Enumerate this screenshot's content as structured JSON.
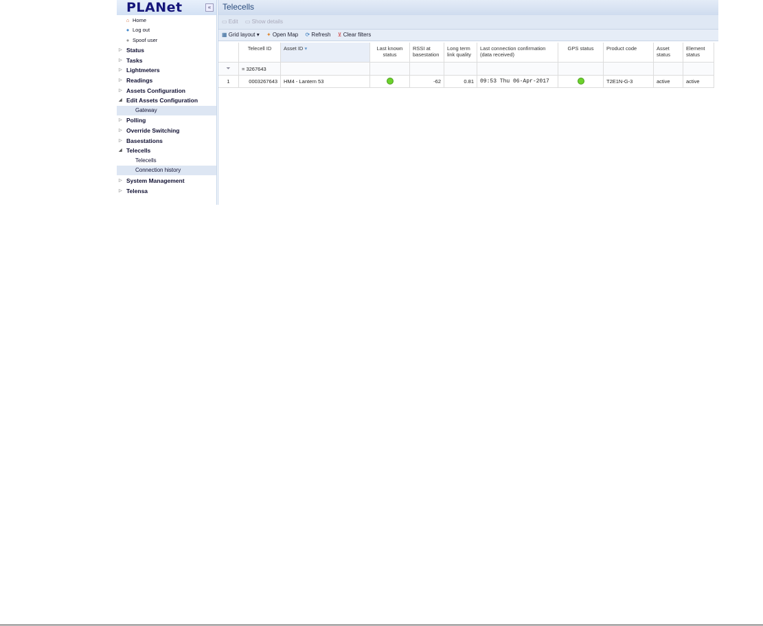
{
  "sidebar": {
    "logo": "PLANet",
    "collapse": "«",
    "links": [
      {
        "label": "Home",
        "icon": "home-icon"
      },
      {
        "label": "Log out",
        "icon": "user-icon"
      },
      {
        "label": "Spoof user",
        "icon": "user-icon"
      }
    ],
    "items": [
      "Status",
      "Tasks",
      "Lightmeters",
      "Readings",
      "Assets Configuration",
      "Edit Assets Configuration",
      "Gateway",
      "Polling",
      "Override Switching",
      "Basestations",
      "Telecells",
      "Telecells",
      "Connection history",
      "System Management",
      "Telensa"
    ]
  },
  "main": {
    "title": "Telecells",
    "toolbar1": {
      "edit": "Edit",
      "show_details": "Show details"
    },
    "toolbar2": {
      "grid_layout": "Grid layout",
      "open_map": "Open Map",
      "refresh": "Refresh",
      "clear_filters": "Clear filters"
    },
    "columns": [
      "Telecell ID",
      "Asset ID",
      "Last known status",
      "RSSI at basestation",
      "Long term link quality",
      "Last connection confirmation (data received)",
      "GPS status",
      "Product code",
      "Asset status",
      "Element status"
    ],
    "filter": {
      "telecell_id": "= 3267643"
    },
    "rows": [
      {
        "num": "1",
        "telecell_id": "0003267643",
        "asset_id": "HM4 - Lantern 53",
        "last_known_status": "green",
        "rssi": "-62",
        "link_quality": "0.81",
        "last_connection": "09:53 Thu 06-Apr-2017",
        "gps_status": "green",
        "product_code": "T2E1N-G-3",
        "asset_status": "active",
        "element_status": "active"
      }
    ]
  },
  "colors": {
    "status_green": "#6cd22c",
    "title": "#2a4c7c"
  }
}
